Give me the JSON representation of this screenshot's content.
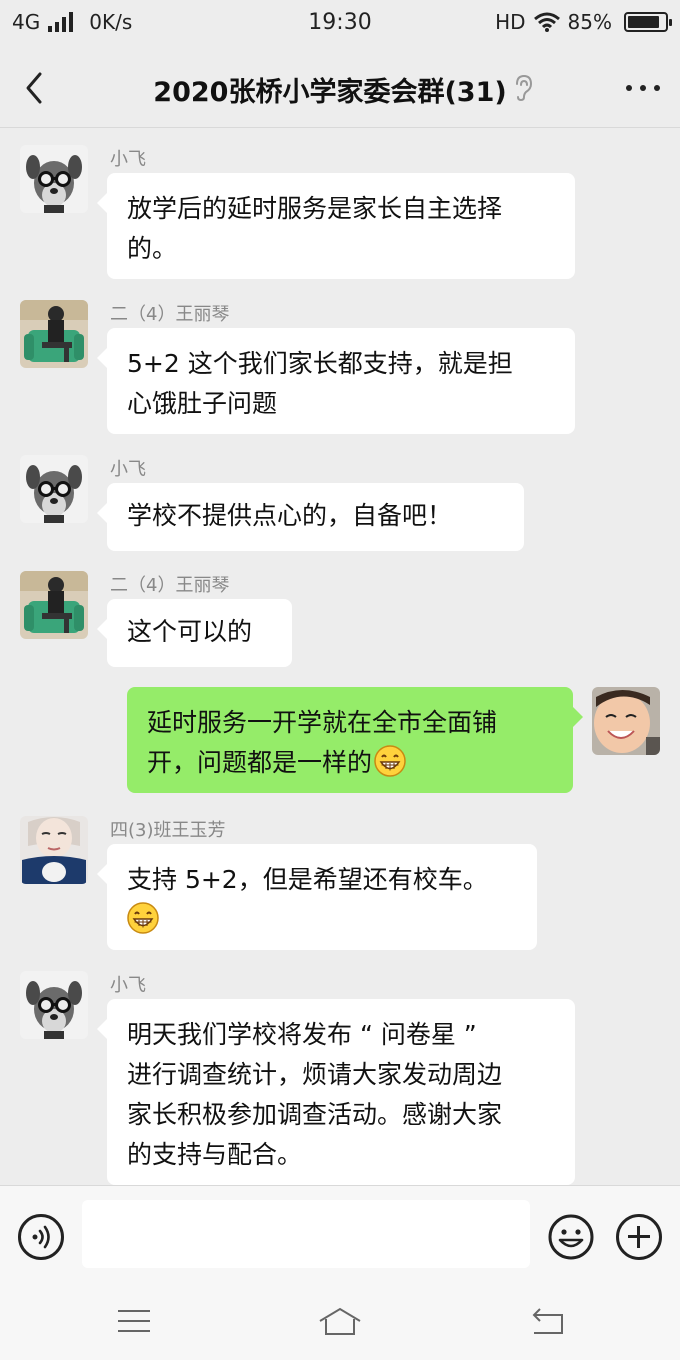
{
  "status_bar": {
    "network": "4G",
    "speed": "0K/s",
    "time": "19:30",
    "hd": "HD",
    "battery": "85%",
    "battery_level": 0.85
  },
  "header": {
    "title": "2020张桥小学家委会群(31)",
    "back_icon": "chevron-left-icon",
    "more_icon": "more-dots-icon",
    "muted_icon": "ear-icon"
  },
  "messages": [
    {
      "side": "left",
      "sender": "小飞",
      "lines": [
        "放学后的延时服务是家长自主选择",
        "的。"
      ],
      "avatar": "dog-with-glasses"
    },
    {
      "side": "left",
      "sender": "二（4）王丽琴",
      "lines": [
        "5+2 这个我们家长都支持，就是担",
        "心饿肚子问题"
      ],
      "avatar": "person-on-green-chair"
    },
    {
      "side": "left",
      "sender": "小飞",
      "lines": [
        "学校不提供点心的，自备吧！"
      ],
      "avatar": "dog-with-glasses"
    },
    {
      "side": "left",
      "sender": "二（4）王丽琴",
      "lines": [
        "这个可以的"
      ],
      "avatar": "person-on-green-chair"
    },
    {
      "side": "right",
      "sender": "",
      "lines": [
        "延时服务一开学就在全市全面铺",
        "开，问题都是一样的"
      ],
      "emoji": "grin-emoji",
      "avatar": "smiling-child"
    },
    {
      "side": "left",
      "sender": "四(3)班王玉芳",
      "lines": [
        "支持 5+2，但是希望还有校车。"
      ],
      "emoji": "grin-emoji",
      "avatar": "woman-portrait"
    },
    {
      "side": "left",
      "sender": "小飞",
      "lines": [
        "明天我们学校将发布 “ 问卷星 ”",
        "进行调查统计，烦请大家发动周边",
        "家长积极参加调查活动。感谢大家",
        "的支持与配合。"
      ],
      "avatar": "dog-with-glasses"
    }
  ],
  "input_bar": {
    "voice_icon": "voice-icon",
    "input_value": "",
    "emoji_icon": "emoji-icon",
    "plus_icon": "plus-icon"
  },
  "system_nav": {
    "menu_icon": "menu-icon",
    "home_icon": "home-icon",
    "back_icon": "back-arrow-icon"
  },
  "colors": {
    "background": "#ededed",
    "bubble_self": "#95ec69",
    "bubble_other": "#ffffff"
  }
}
